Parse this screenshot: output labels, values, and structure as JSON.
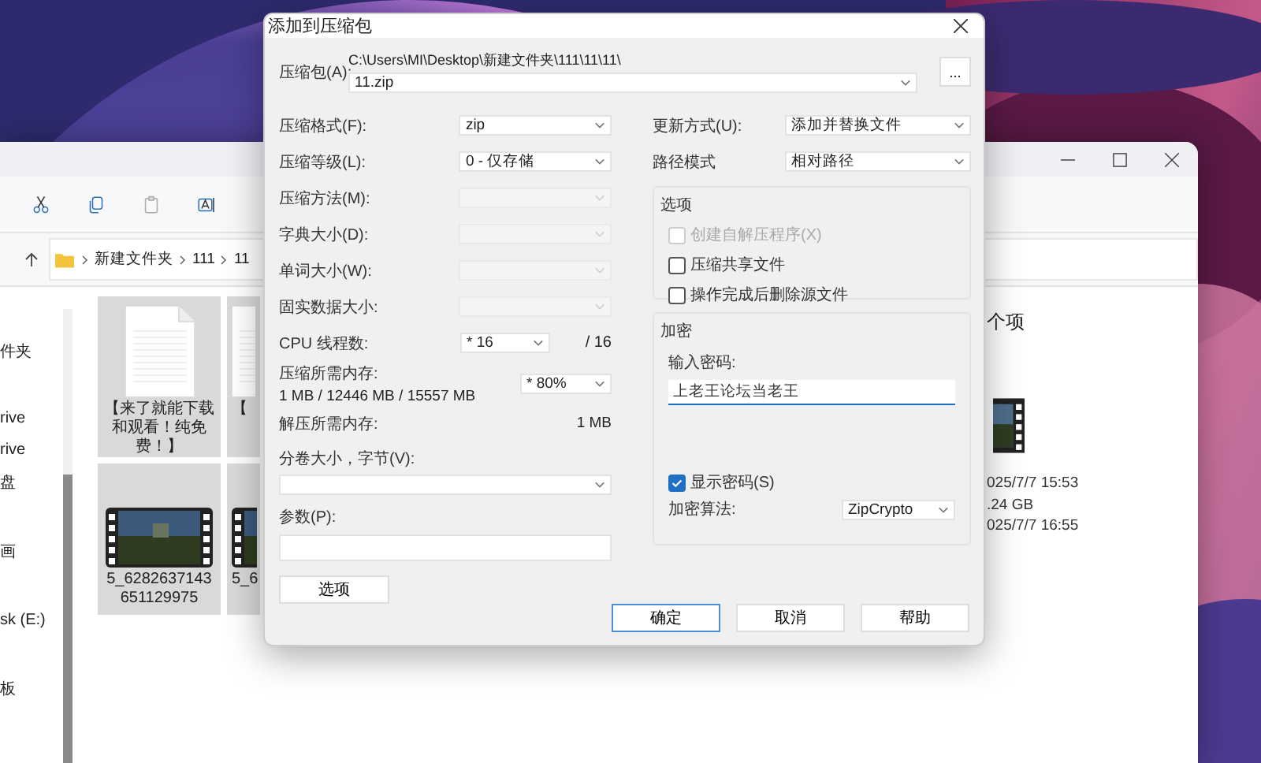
{
  "explorer": {
    "breadcrumb": [
      "新建文件夹",
      "111",
      "11"
    ],
    "nav_items": [
      "件夹",
      "rive",
      "rive",
      "盘",
      "画",
      "sk (E:)",
      "板"
    ],
    "files": [
      {
        "name": "【来了就能下载和观看！纯免费！】",
        "kind": "document"
      },
      {
        "name": "【",
        "kind": "document"
      },
      {
        "name": "5_6282637143651129975",
        "kind": "video"
      },
      {
        "name": "5_6",
        "kind": "video"
      }
    ],
    "details": {
      "heading": "个项",
      "lines": [
        "025/7/7 15:53",
        ".24 GB",
        "025/7/7 16:55"
      ]
    }
  },
  "dialog": {
    "title": "添加到压缩包",
    "archive": {
      "label": "压缩包(A):",
      "path": "C:\\Users\\MI\\Desktop\\新建文件夹\\111\\11\\11\\",
      "value": "11.zip",
      "browse": "..."
    },
    "left_fields": [
      {
        "kind": "combo",
        "label": "压缩格式(F):",
        "value": "zip",
        "disabled": false
      },
      {
        "kind": "combo",
        "label": "压缩等级(L):",
        "value": "0 - 仅存储",
        "disabled": false
      },
      {
        "kind": "combo",
        "label": "压缩方法(M):",
        "disabled": true
      },
      {
        "kind": "combo",
        "label": "字典大小(D):",
        "disabled": true
      },
      {
        "kind": "combo",
        "label": "单词大小(W):",
        "disabled": true
      },
      {
        "kind": "combo",
        "label": "固实数据大小:",
        "disabled": true
      },
      {
        "kind": "cpu",
        "label": "CPU 线程数:",
        "value": "* 16",
        "note": "/ 16"
      },
      {
        "kind": "memory",
        "label": "压缩所需内存:",
        "detail": "1 MB / 12446 MB / 15557 MB",
        "value": "* 80%"
      },
      {
        "kind": "info",
        "label": "解压所需内存:",
        "note": "1 MB"
      }
    ],
    "volume": {
      "label": "分卷大小，字节(V):"
    },
    "params": {
      "label": "参数(P):"
    },
    "options_button": "选项",
    "update_mode": {
      "label": "更新方式(U):",
      "value": "添加并替换文件"
    },
    "path_mode": {
      "label": "路径模式",
      "value": "相对路径"
    },
    "options_group": {
      "title": "选项",
      "checkboxes": [
        {
          "label": "创建自解压程序(X)",
          "checked": false,
          "disabled": true
        },
        {
          "label": "压缩共享文件",
          "checked": false,
          "disabled": false
        },
        {
          "label": "操作完成后删除源文件",
          "checked": false,
          "disabled": false
        }
      ]
    },
    "encryption": {
      "title": "加密",
      "password_label": "输入密码:",
      "password": "上老王论坛当老王",
      "show_password": {
        "label": "显示密码(S)",
        "checked": true
      },
      "method_label": "加密算法:",
      "method": "ZipCrypto"
    },
    "buttons": [
      {
        "label": "确定",
        "default": true
      },
      {
        "label": "取消",
        "default": false
      },
      {
        "label": "帮助",
        "default": false
      }
    ]
  }
}
